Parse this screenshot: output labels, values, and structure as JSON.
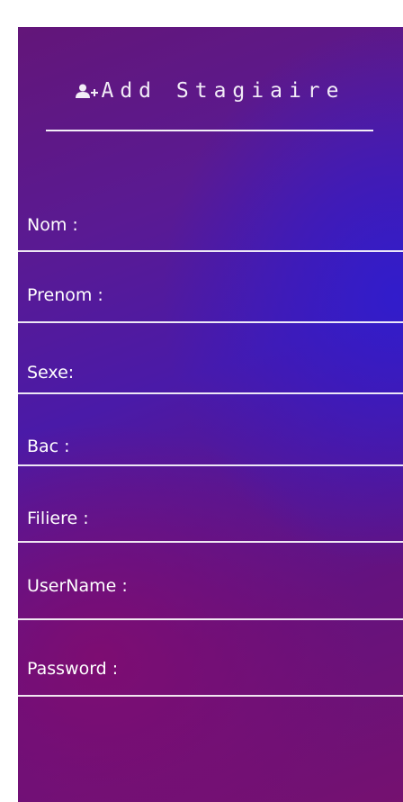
{
  "form": {
    "title": "Add Stagiaire",
    "title_icon": "add-user-icon",
    "fields": [
      {
        "label": "Nom :"
      },
      {
        "label": "Prenom :"
      },
      {
        "label": "Sexe:"
      },
      {
        "label": "Bac :"
      },
      {
        "label": "Filiere :"
      },
      {
        "label": "UserName :"
      },
      {
        "label": "Password :"
      }
    ]
  },
  "colors": {
    "gradient_blue": "#301ccd",
    "gradient_purple": "#5a1a93",
    "gradient_magenta": "#800c70",
    "text": "#ffffff"
  }
}
